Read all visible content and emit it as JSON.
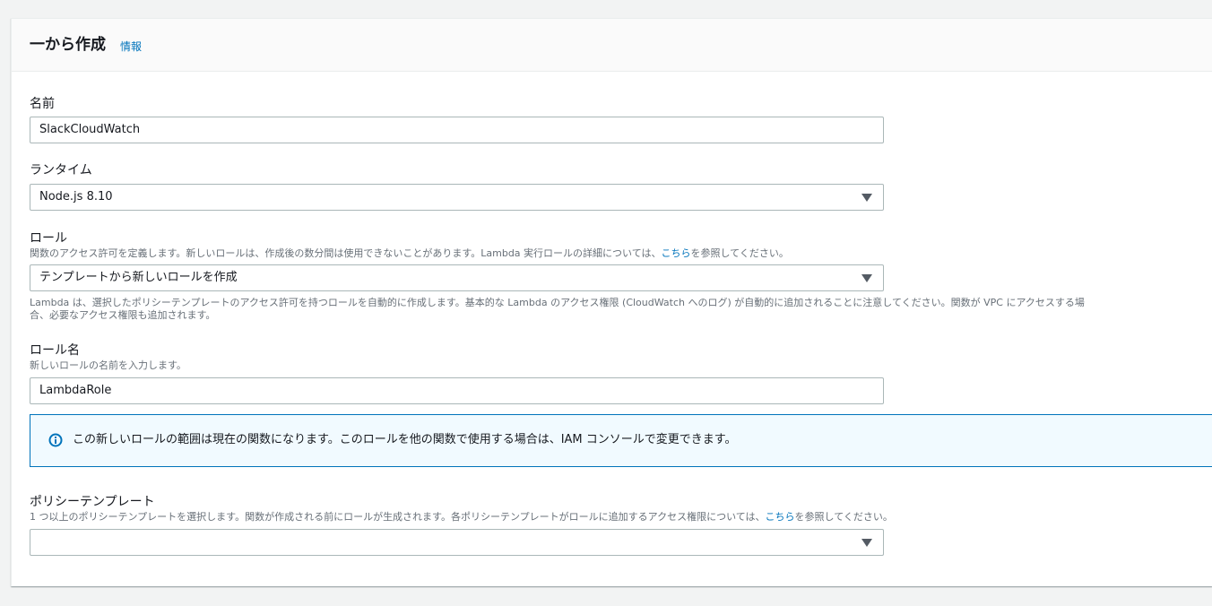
{
  "header": {
    "title": "一から作成",
    "info_link": "情報"
  },
  "name_field": {
    "label": "名前",
    "value": "SlackCloudWatch"
  },
  "runtime_field": {
    "label": "ランタイム",
    "value": "Node.js 8.10"
  },
  "role_field": {
    "label": "ロール",
    "desc_before": "関数のアクセス許可を定義します。新しいロールは、作成後の数分間は使用できないことがあります。Lambda 実行ロールの詳細については、",
    "desc_link": "こちら",
    "desc_after": "を参照してください。",
    "value": "テンプレートから新しいロールを作成",
    "note_line1": "Lambda は、選択したポリシーテンプレートのアクセス許可を持つロールを自動的に作成します。基本的な Lambda のアクセス権限 (CloudWatch へのログ) が自動的に追加されることに注意してください。関数が VPC にアクセスする場",
    "note_line2": "合、必要なアクセス権限も追加されます。"
  },
  "role_name_field": {
    "label": "ロール名",
    "desc": "新しいロールの名前を入力します。",
    "value": "LambdaRole"
  },
  "info_alert": {
    "icon": "info-icon",
    "text": "この新しいロールの範囲は現在の関数になります。このロールを他の関数で使用する場合は、IAM コンソールで変更できます。"
  },
  "policy_template_field": {
    "label": "ポリシーテンプレート",
    "desc_before": "1 つ以上のポリシーテンプレートを選択します。関数が作成される前にロールが生成されます。各ポリシーテンプレートがロールに追加するアクセス権限については、",
    "desc_link": "こちら",
    "desc_after": "を参照してください。",
    "value": ""
  },
  "colors": {
    "link": "#0073bb",
    "alert_bg": "#f1faff",
    "alert_border": "#0073bb"
  }
}
